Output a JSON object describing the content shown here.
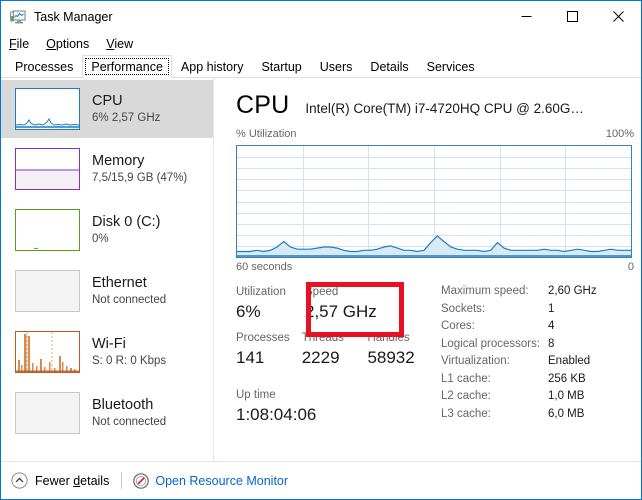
{
  "window": {
    "title": "Task Manager",
    "icon": "task-manager-icon",
    "controls": {
      "minimize": "minimize-icon",
      "maximize": "maximize-icon",
      "close": "close-icon"
    }
  },
  "menu": {
    "items": [
      {
        "label": "File",
        "accel": "F"
      },
      {
        "label": "Options",
        "accel": "O"
      },
      {
        "label": "View",
        "accel": "V"
      }
    ]
  },
  "tabs": {
    "selected": "Performance",
    "items": [
      {
        "label": "Processes"
      },
      {
        "label": "Performance"
      },
      {
        "label": "App history"
      },
      {
        "label": "Startup"
      },
      {
        "label": "Users"
      },
      {
        "label": "Details"
      },
      {
        "label": "Services"
      }
    ]
  },
  "sidebar": {
    "items": [
      {
        "name": "CPU",
        "title": "CPU",
        "sub": "6%  2,57 GHz",
        "color": "#1a7fc1",
        "selected": true,
        "graph": "cpu"
      },
      {
        "name": "Memory",
        "title": "Memory",
        "sub": "7,5/15,9 GB (47%)",
        "color": "#8a31b0",
        "selected": false,
        "graph": "memory",
        "fill_percent": 47
      },
      {
        "name": "Disk",
        "title": "Disk 0 (C:)",
        "sub": "0%",
        "color": "#5a9e1b",
        "selected": false,
        "graph": "disk"
      },
      {
        "name": "Ethernet",
        "title": "Ethernet",
        "sub": "Not connected",
        "color": "#b8b8b8",
        "selected": false,
        "graph": "empty"
      },
      {
        "name": "Wi-Fi",
        "title": "Wi-Fi",
        "sub": "S: 0 R: 0 Kbps",
        "color": "#c0581f",
        "selected": false,
        "graph": "wifi"
      },
      {
        "name": "Bluetooth",
        "title": "Bluetooth",
        "sub": "Not connected",
        "color": "#b8b8b8",
        "selected": false,
        "graph": "empty"
      }
    ]
  },
  "main": {
    "title": "CPU",
    "subtitle": "Intel(R) Core(TM) i7-4720HQ CPU @ 2.60G…",
    "axis_label": "% Utilization",
    "axis_max": "100%",
    "time_label": "60 seconds",
    "time_zero": "0",
    "stats": {
      "utilization_label": "Utilization",
      "utilization_value": "6%",
      "speed_label": "Speed",
      "speed_value": "2,57 GHz",
      "processes_label": "Processes",
      "processes_value": "141",
      "threads_label": "Threads",
      "threads_value": "2229",
      "handles_label": "Handles",
      "handles_value": "58932",
      "uptime_label": "Up time",
      "uptime_value": "1:08:04:06"
    },
    "specs": [
      {
        "key": "Maximum speed:",
        "value": "2,60 GHz"
      },
      {
        "key": "Sockets:",
        "value": "1"
      },
      {
        "key": "Cores:",
        "value": "4"
      },
      {
        "key": "Logical processors:",
        "value": "8"
      },
      {
        "key": "Virtualization:",
        "value": "Enabled"
      },
      {
        "key": "L1 cache:",
        "value": "256 KB"
      },
      {
        "key": "L2 cache:",
        "value": "1,0 MB"
      },
      {
        "key": "L3 cache:",
        "value": "6,0 MB"
      }
    ]
  },
  "annotation": {
    "color": "#e81123",
    "target": "speed-stat"
  },
  "statusbar": {
    "fewer_details": "Fewer details",
    "fewer_details_accel": "d",
    "open_resource_monitor": "Open Resource Monitor",
    "link_color": "#0066cc"
  },
  "chart_data": {
    "type": "area",
    "title": "CPU % Utilization",
    "ylabel": "% Utilization",
    "xlabel": "60 seconds",
    "ylim": [
      0,
      100
    ],
    "xlim": [
      60,
      0
    ],
    "grid": true,
    "grid_cols": 6,
    "grid_rows": 10,
    "series": [
      {
        "name": "CPU utilization",
        "color": "#1a7fc1",
        "fill": "#daeaf5",
        "values": [
          5,
          5,
          5,
          6,
          5,
          6,
          9,
          14,
          9,
          7,
          7,
          7,
          8,
          9,
          9,
          8,
          6,
          5,
          5,
          6,
          6,
          7,
          9,
          10,
          8,
          6,
          6,
          5,
          6,
          13,
          19,
          14,
          9,
          7,
          6,
          6,
          6,
          5,
          6,
          13,
          8,
          6,
          6,
          6,
          6,
          6,
          7,
          6,
          6,
          5,
          6,
          7,
          6,
          5,
          5,
          6,
          7,
          6,
          6,
          6
        ]
      }
    ]
  }
}
